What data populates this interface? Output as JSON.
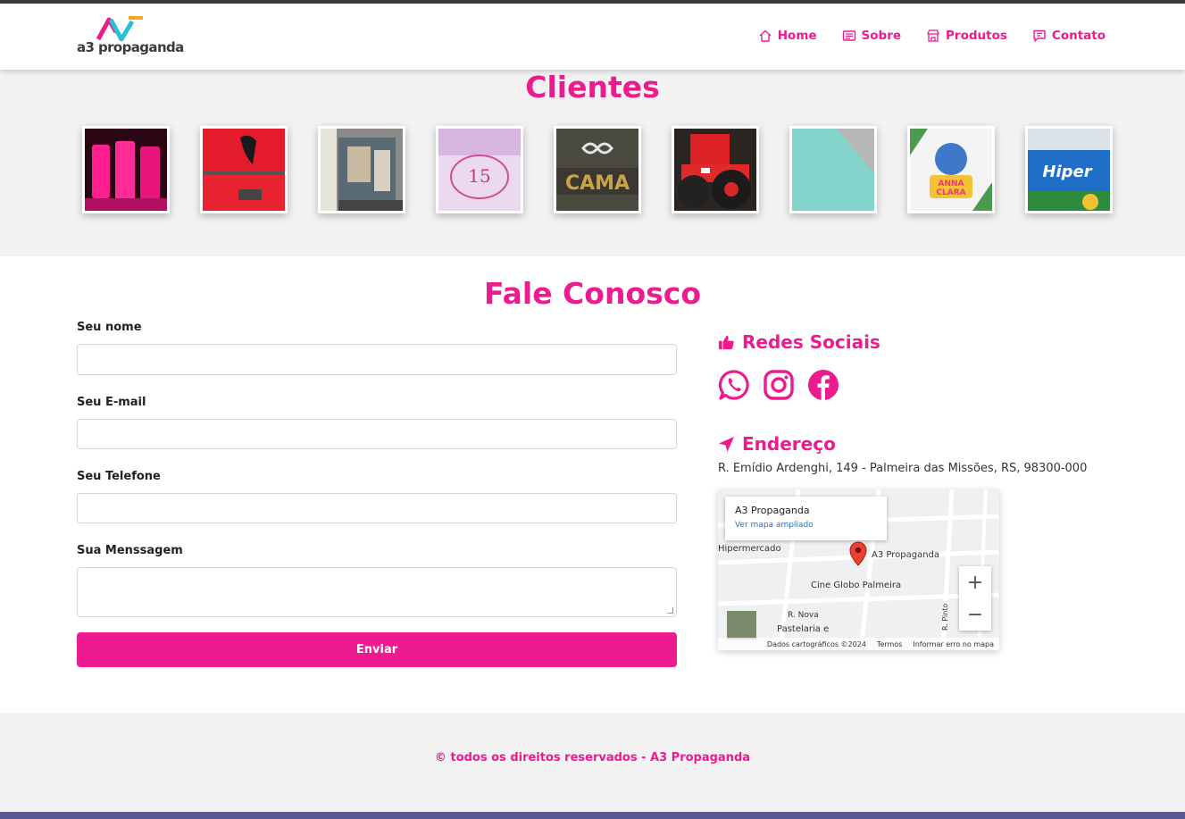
{
  "brand": {
    "name": "a3 propaganda",
    "accent_color": "#ec1c8f",
    "logo_colors": [
      "#ec1c8f",
      "#2bbfd6",
      "#f5a623",
      "#3b3b3b"
    ]
  },
  "nav": {
    "items": [
      {
        "label": "Home",
        "icon": "home-icon"
      },
      {
        "label": "Sobre",
        "icon": "document-icon"
      },
      {
        "label": "Produtos",
        "icon": "store-icon"
      },
      {
        "label": "Contato",
        "icon": "chat-icon"
      }
    ]
  },
  "clients": {
    "title": "Clientes",
    "thumbnails": [
      "pink-cups",
      "red-truck",
      "window-graphic",
      "15-party-floor",
      "camaro-sign",
      "red-tractor",
      "teal-card",
      "anna-clara-invite",
      "hiper-facil-storefront"
    ]
  },
  "contact": {
    "title": "Fale Conosco",
    "form": {
      "name_label": "Seu nome",
      "email_label": "Seu E-mail",
      "phone_label": "Seu Telefone",
      "message_label": "Sua Menssagem",
      "submit_label": "Enviar"
    },
    "social": {
      "title": "Redes Sociais",
      "icons": [
        "whatsapp-icon",
        "instagram-icon",
        "facebook-icon"
      ]
    },
    "address": {
      "title": "Endereço",
      "text": "R. Emídio Ardenghi, 149 - Palmeira das Missões, RS, 98300-000"
    },
    "map": {
      "place_name": "A3 Propaganda",
      "link_label": "Ver mapa ampliado",
      "pin_label": "A3 Propaganda",
      "labels": [
        "Hipermercado",
        "Cine Globo Palmeira",
        "R. Nova",
        "Pastelaria e",
        "R. Pinto"
      ],
      "footer": [
        "Dados cartográficos ©2024",
        "Termos",
        "Informar erro no mapa"
      ]
    }
  },
  "footer": {
    "text": "© todos os direitos reservados - A3 Propaganda"
  }
}
